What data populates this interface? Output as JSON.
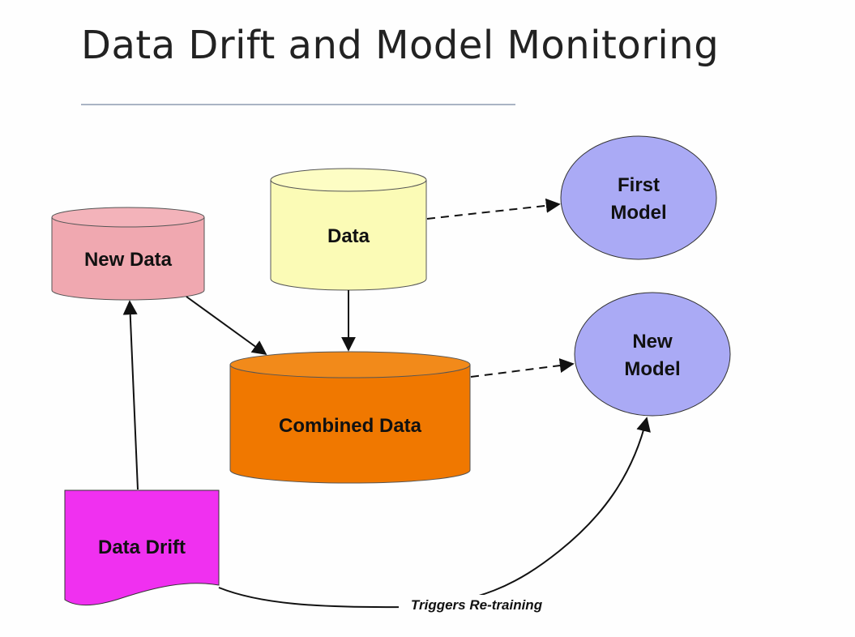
{
  "slide": {
    "title": "Data Drift and Model Monitoring"
  },
  "diagram": {
    "nodes": {
      "new_data": {
        "label": "New Data",
        "color": "#f0a8b0"
      },
      "data": {
        "label": "Data",
        "color": "#fbfbb6"
      },
      "combined_data": {
        "label": "Combined Data",
        "color": "#f07800"
      },
      "first_model": {
        "label_lines": [
          "First",
          "Model"
        ],
        "color": "#aaaaf5"
      },
      "new_model": {
        "label_lines": [
          "New",
          "Model"
        ],
        "color": "#aaaaf5"
      },
      "data_drift": {
        "label": "Data Drift",
        "color": "#f030f0"
      }
    },
    "edges": {
      "retrain_label": "Triggers Re-training"
    }
  }
}
